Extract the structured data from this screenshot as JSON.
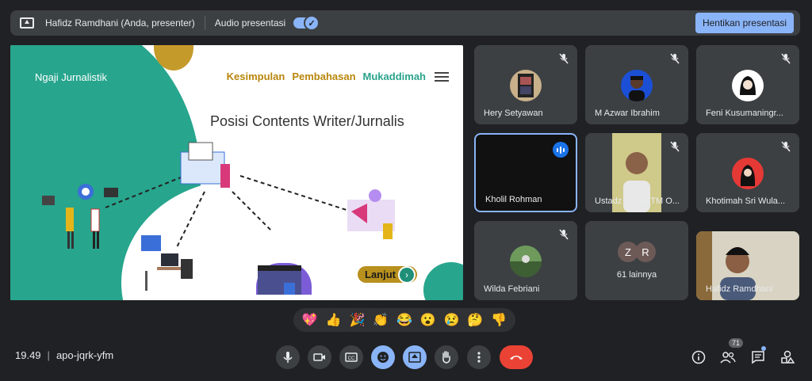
{
  "topbar": {
    "presenter_text": "Hafidz Ramdhani (Anda, presenter)",
    "audio_label": "Audio presentasi",
    "audio_enabled": true,
    "stop_button": "Hentikan presentasi"
  },
  "slide": {
    "brand": "Ngaji Jurnalistik",
    "nav": [
      "Kesimpulan",
      "Pembahasan",
      "Mukaddimah"
    ],
    "heading": "Posisi Contents Writer/Jurnalis",
    "next_button": "Lanjut"
  },
  "participants": [
    {
      "name": "Hery Setyawan",
      "muted": true
    },
    {
      "name": "M Azwar Ibrahim",
      "muted": true
    },
    {
      "name": "Feni Kusumaningr...",
      "muted": true
    },
    {
      "name": "Kholil Rohman",
      "muted": false,
      "speaking": true
    },
    {
      "name": "Ustadz Yahya TM O...",
      "muted": true
    },
    {
      "name": "Khotimah Sri Wula...",
      "muted": true
    },
    {
      "name": "Wilda Febriani",
      "muted": true
    },
    {
      "name": "Hafidz Ramdhani",
      "muted": false
    }
  ],
  "others_tile": {
    "initials": [
      "Z",
      "R"
    ],
    "label": "61 lainnya"
  },
  "reactions": [
    "💖",
    "👍",
    "🎉",
    "👏",
    "😂",
    "😮",
    "😢",
    "🤔",
    "👎"
  ],
  "bottom": {
    "time": "19.49",
    "meeting_code": "apo-jqrk-yfm",
    "participant_count": "71"
  },
  "colors": {
    "accent": "#8ab4f8",
    "end_call": "#ea4335",
    "slide_green": "#27a58d",
    "slide_gold": "#c49a2a"
  }
}
